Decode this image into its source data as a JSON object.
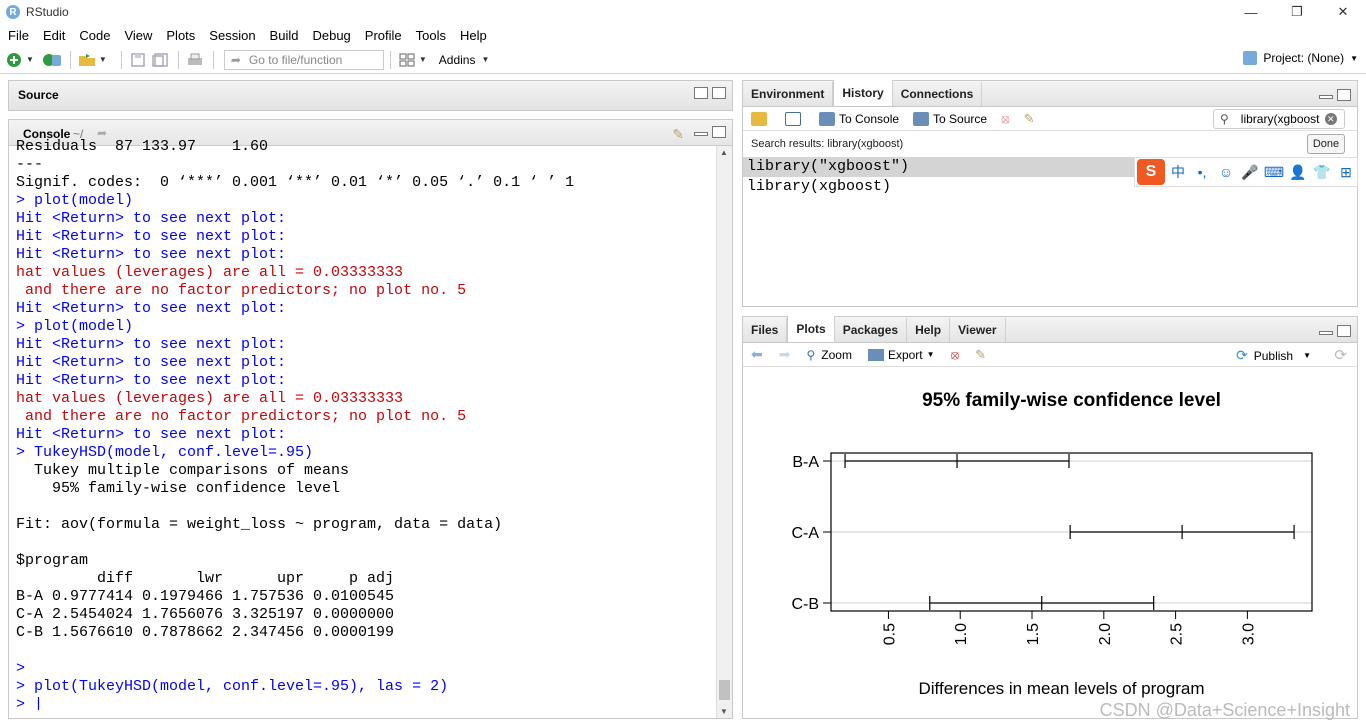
{
  "window": {
    "title": "RStudio",
    "logo": "R"
  },
  "menu": [
    "File",
    "Edit",
    "Code",
    "View",
    "Plots",
    "Session",
    "Build",
    "Debug",
    "Profile",
    "Tools",
    "Help"
  ],
  "toolbar": {
    "goto_placeholder": "Go to file/function",
    "addins": "Addins",
    "project": "Project: (None)"
  },
  "source": {
    "label": "Source"
  },
  "console": {
    "label": "Console",
    "path": "~/",
    "lines": [
      {
        "t": "Residuals  87 133.97    1.60",
        "c": "out"
      },
      {
        "t": "---",
        "c": "out"
      },
      {
        "t": "Signif. codes:  0 ‘***’ 0.001 ‘**’ 0.01 ‘*’ 0.05 ‘.’ 0.1 ‘ ’ 1",
        "c": "out"
      },
      {
        "t": "> plot(model)",
        "c": "in"
      },
      {
        "t": "Hit <Return> to see next plot:",
        "c": "in"
      },
      {
        "t": "Hit <Return> to see next plot:",
        "c": "in"
      },
      {
        "t": "Hit <Return> to see next plot:",
        "c": "in"
      },
      {
        "t": "hat values (leverages) are all = 0.03333333",
        "c": "err"
      },
      {
        "t": " and there are no factor predictors; no plot no. 5",
        "c": "err"
      },
      {
        "t": "Hit <Return> to see next plot:",
        "c": "in"
      },
      {
        "t": "> plot(model)",
        "c": "in"
      },
      {
        "t": "Hit <Return> to see next plot:",
        "c": "in"
      },
      {
        "t": "Hit <Return> to see next plot:",
        "c": "in"
      },
      {
        "t": "Hit <Return> to see next plot:",
        "c": "in"
      },
      {
        "t": "hat values (leverages) are all = 0.03333333",
        "c": "err"
      },
      {
        "t": " and there are no factor predictors; no plot no. 5",
        "c": "err"
      },
      {
        "t": "Hit <Return> to see next plot:",
        "c": "in"
      },
      {
        "t": "> TukeyHSD(model, conf.level=.95)",
        "c": "in"
      },
      {
        "t": "  Tukey multiple comparisons of means",
        "c": "out"
      },
      {
        "t": "    95% family-wise confidence level",
        "c": "out"
      },
      {
        "t": "",
        "c": "out"
      },
      {
        "t": "Fit: aov(formula = weight_loss ~ program, data = data)",
        "c": "out"
      },
      {
        "t": "",
        "c": "out"
      },
      {
        "t": "$program",
        "c": "out"
      },
      {
        "t": "         diff       lwr      upr     p adj",
        "c": "out"
      },
      {
        "t": "B-A 0.9777414 0.1979466 1.757536 0.0100545",
        "c": "out"
      },
      {
        "t": "C-A 2.5454024 1.7656076 3.325197 0.0000000",
        "c": "out"
      },
      {
        "t": "C-B 1.5676610 0.7878662 2.347456 0.0000199",
        "c": "out"
      },
      {
        "t": "",
        "c": "out"
      },
      {
        "t": ">",
        "c": "in"
      },
      {
        "t": "> plot(TukeyHSD(model, conf.level=.95), las = 2)",
        "c": "in"
      },
      {
        "t": "> |",
        "c": "in"
      }
    ]
  },
  "env": {
    "tabs": [
      "Environment",
      "History",
      "Connections"
    ],
    "active_tab": "History",
    "to_console": "To Console",
    "to_source": "To Source",
    "search_value": "library(xgboost",
    "search_results": "Search results: library(xgboost)",
    "done": "Done",
    "history": [
      "library(\"xgboost\")",
      "library(xgboost)"
    ]
  },
  "ime": {
    "logo": "S",
    "items": [
      "中",
      "•,",
      "☺",
      "🎤",
      "⌨",
      "👤",
      "👕",
      "⊞"
    ]
  },
  "plots": {
    "tabs": [
      "Files",
      "Plots",
      "Packages",
      "Help",
      "Viewer"
    ],
    "active_tab": "Plots",
    "zoom": "Zoom",
    "export": "Export",
    "publish": "Publish"
  },
  "chart_data": {
    "type": "errorbar",
    "title": "95% family-wise confidence level",
    "xlabel": "Differences in mean levels of program",
    "ylabel": "",
    "categories": [
      "B-A",
      "C-A",
      "C-B"
    ],
    "diff": [
      0.9777414,
      2.5454024,
      1.567661
    ],
    "lwr": [
      0.1979466,
      1.7656076,
      0.7878662
    ],
    "upr": [
      1.757536,
      3.325197,
      2.347456
    ],
    "xticks": [
      "0.5",
      "1.0",
      "1.5",
      "2.0",
      "2.5",
      "3.0"
    ],
    "xlim": [
      0.1,
      3.45
    ],
    "grid": "horizontal"
  },
  "watermark": "CSDN @Data+Science+Insight"
}
